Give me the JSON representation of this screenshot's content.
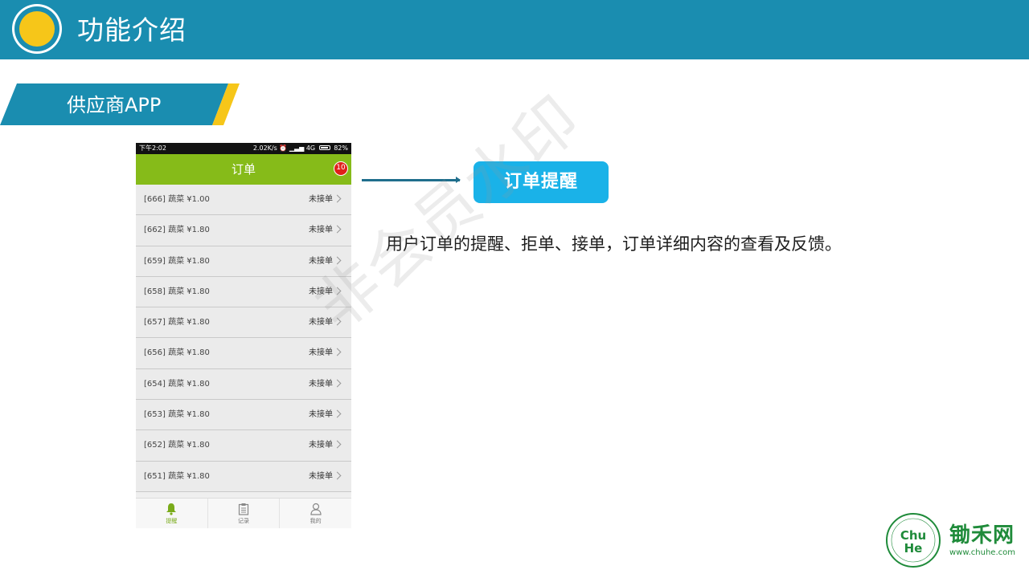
{
  "header": {
    "title": "功能介绍"
  },
  "section": {
    "label": "供应商APP"
  },
  "phone": {
    "status_bar": {
      "time": "下午2:02",
      "network_speed": "2.02K/s",
      "network_type": "4G",
      "battery": "82%"
    },
    "header": {
      "title": "订单",
      "badge_count": "10"
    },
    "orders": [
      {
        "text": "[666] 蔬菜 ¥1.00",
        "status": "未接单"
      },
      {
        "text": "[662] 蔬菜 ¥1.80",
        "status": "未接单"
      },
      {
        "text": "[659] 蔬菜 ¥1.80",
        "status": "未接单"
      },
      {
        "text": "[658] 蔬菜 ¥1.80",
        "status": "未接单"
      },
      {
        "text": "[657] 蔬菜 ¥1.80",
        "status": "未接单"
      },
      {
        "text": "[656] 蔬菜 ¥1.80",
        "status": "未接单"
      },
      {
        "text": "[654] 蔬菜 ¥1.80",
        "status": "未接单"
      },
      {
        "text": "[653] 蔬菜 ¥1.80",
        "status": "未接单"
      },
      {
        "text": "[652] 蔬菜 ¥1.80",
        "status": "未接单"
      },
      {
        "text": "[651] 蔬菜 ¥1.80",
        "status": "未接单"
      }
    ],
    "tabs": [
      {
        "label": "提醒",
        "icon": "bell-icon"
      },
      {
        "label": "记录",
        "icon": "clipboard-icon"
      },
      {
        "label": "我的",
        "icon": "person-icon"
      }
    ]
  },
  "callout": {
    "label": "订单提醒"
  },
  "description": "用户订单的提醒、拒单、接单，订单详细内容的查看及反馈。",
  "watermark": "非会员水印",
  "brand": {
    "name": "锄禾网",
    "url": "www.chuhe.com"
  },
  "colors": {
    "header_bg": "#1a8db0",
    "accent_yellow": "#f6c619",
    "app_green": "#86bb19",
    "callout_blue": "#1ab2e8",
    "badge_red": "#e0201a",
    "brand_green": "#1f8b3a"
  }
}
